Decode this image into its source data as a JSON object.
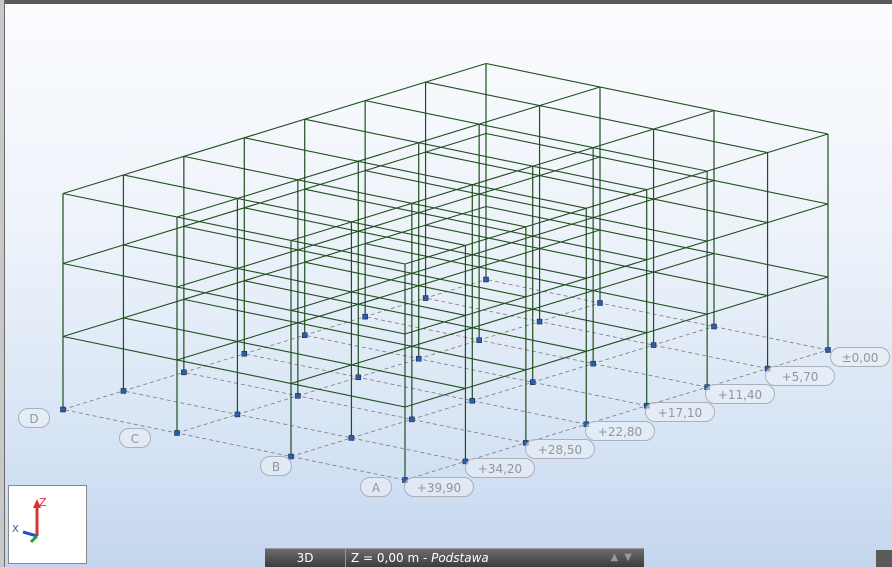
{
  "grid_axes": [
    "D",
    "C",
    "B",
    "A"
  ],
  "levels": [
    "±0,00",
    "+5,70",
    "+11,40",
    "+17,10",
    "+22,80",
    "+28,50",
    "+34,20",
    "+39,90"
  ],
  "triad": {
    "x": "X",
    "z": "Z"
  },
  "statusbar": {
    "view_button": "3D",
    "level_value": "Z = 0,00 m - ",
    "level_name": "Podstawa",
    "up_icon": "▲",
    "down_icon": "▼"
  },
  "colors": {
    "frame": "#1f4f1f",
    "node": "#2a5db0",
    "gridline": "#7a7a7a"
  }
}
